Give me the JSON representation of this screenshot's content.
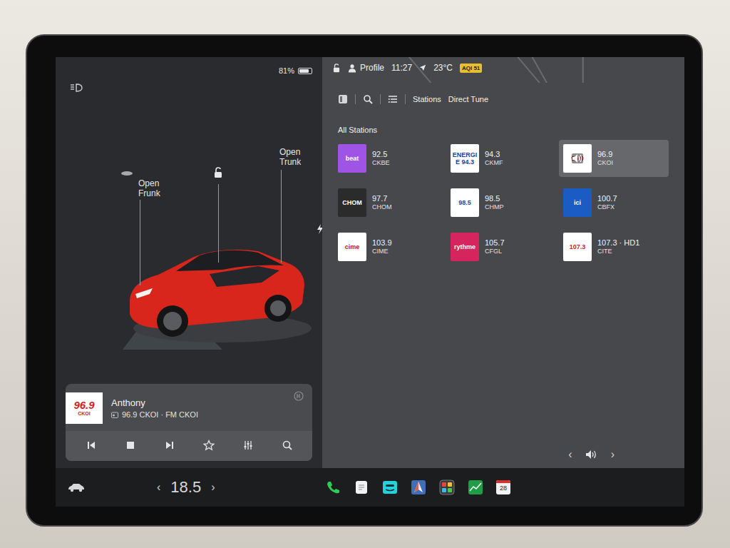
{
  "status": {
    "battery": "81%",
    "battery_level": 0.81,
    "profile": "Profile",
    "time": "11:27",
    "temperature": "23°C",
    "aqi": "AQI 51"
  },
  "car": {
    "frunk": "Open Frunk",
    "trunk": "Open Trunk",
    "locked": false
  },
  "toolbar": [
    "Stations",
    "Direct Tune"
  ],
  "section_title": "All Stations",
  "stations": [
    {
      "logo": "beat",
      "frequency": "92.5",
      "callsign": "CKBE",
      "selected": false,
      "color": "#a054e6",
      "ink": "#ffffff"
    },
    {
      "logo": "ENERGIE 94.3",
      "frequency": "94.3",
      "callsign": "CKMF",
      "selected": false,
      "color": "#ffffff",
      "ink": "#1f3f9a"
    },
    {
      "logo": "96.9",
      "frequency": "96.9",
      "callsign": "CKOI",
      "selected": true,
      "color": "#ffffff",
      "ink": "#d0202a"
    },
    {
      "logo": "CHOM",
      "frequency": "97.7",
      "callsign": "CHOM",
      "selected": false,
      "color": "#2b2b2b",
      "ink": "#ffffff"
    },
    {
      "logo": "98.5",
      "frequency": "98.5",
      "callsign": "CHMP",
      "selected": false,
      "color": "#ffffff",
      "ink": "#1c4f9c"
    },
    {
      "logo": "ici",
      "frequency": "100.7",
      "callsign": "CBFX",
      "selected": false,
      "color": "#1a5bc4",
      "ink": "#ffffff"
    },
    {
      "logo": "cime",
      "frequency": "103.9",
      "callsign": "CIME",
      "selected": false,
      "color": "#ffffff",
      "ink": "#c8102e"
    },
    {
      "logo": "rythme",
      "frequency": "105.7",
      "callsign": "CFGL",
      "selected": false,
      "color": "#d6245e",
      "ink": "#ffffff"
    },
    {
      "logo": "107.3",
      "frequency": "107.3 · HD1",
      "callsign": "CITE",
      "selected": false,
      "color": "#ffffff",
      "ink": "#d0202a"
    }
  ],
  "now_playing": {
    "logo_freq": "96.9",
    "logo_name": "CKOI",
    "title": "Anthony",
    "subtitle": "96.9 CKOI · FM CKOI"
  },
  "climate": {
    "temperature": "18.5",
    "decrease": "‹",
    "increase": "›"
  },
  "dock": {
    "calendar_day": "28"
  },
  "volume": {
    "decrease": "‹",
    "increase": "›"
  }
}
